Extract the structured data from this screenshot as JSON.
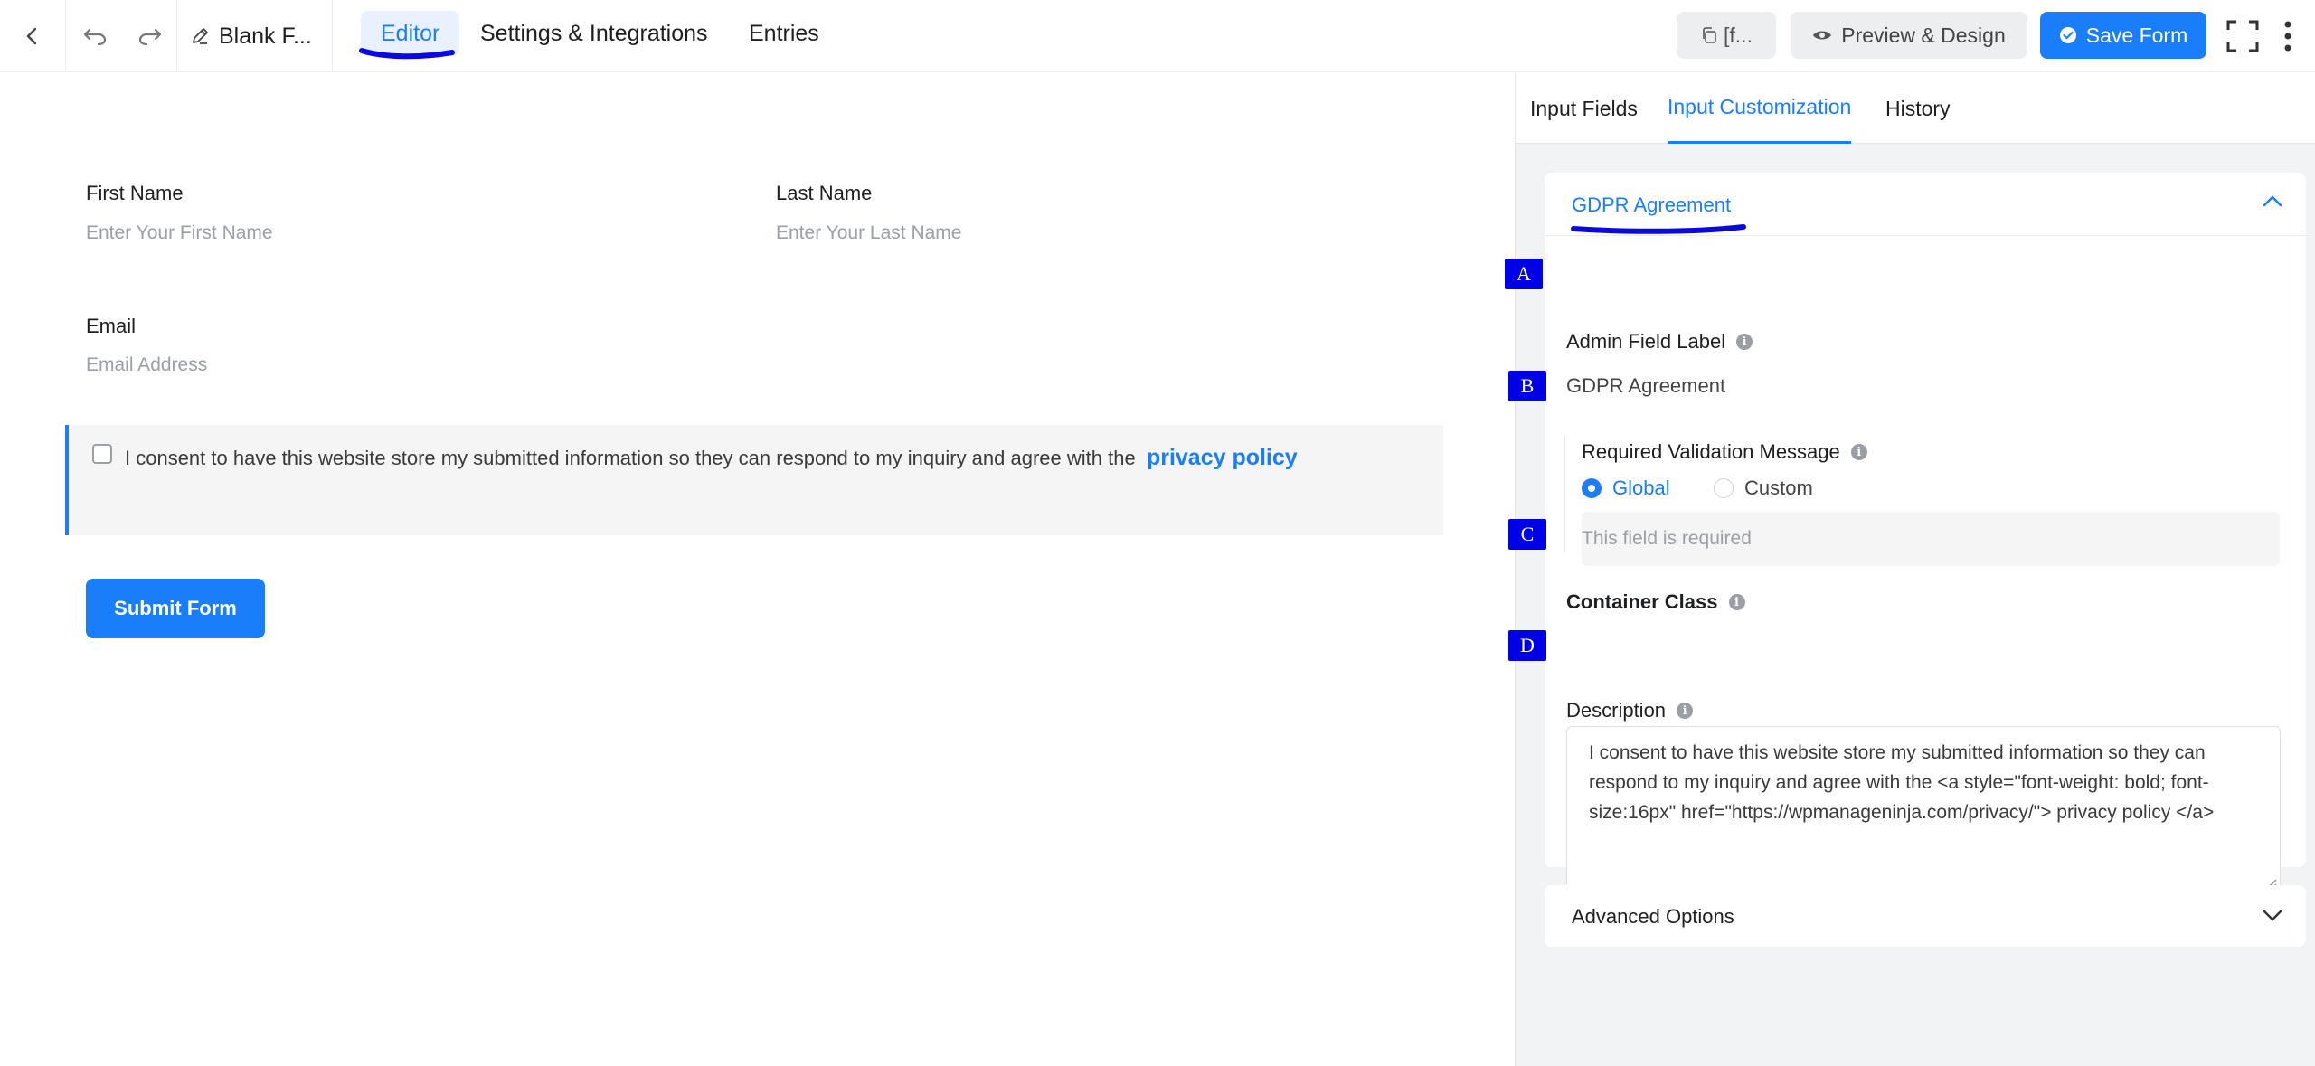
{
  "topbar": {
    "form_title": "Blank F...",
    "tabs": [
      {
        "label": "Editor",
        "active": true
      },
      {
        "label": "Settings & Integrations",
        "active": false
      },
      {
        "label": "Entries",
        "active": false
      }
    ],
    "shortcode_label": "[f...",
    "preview_label": "Preview & Design",
    "save_label": "Save Form"
  },
  "form": {
    "first_name": {
      "label": "First Name",
      "placeholder": "Enter Your First Name"
    },
    "last_name": {
      "label": "Last Name",
      "placeholder": "Enter Your Last Name"
    },
    "email": {
      "label": "Email",
      "placeholder": "Email Address"
    },
    "consent_text": "I consent to have this website store my submitted information so they can respond to my inquiry and agree with the",
    "consent_link": "privacy policy",
    "submit_label": "Submit Form"
  },
  "panel": {
    "tabs": [
      {
        "label": "Input Fields",
        "active": false
      },
      {
        "label": "Input Customization",
        "active": true
      },
      {
        "label": "History",
        "active": false
      }
    ],
    "section_title": "GDPR Agreement",
    "markers": [
      "A",
      "B",
      "C",
      "D"
    ],
    "admin_label": {
      "label": "Admin Field Label",
      "value": "GDPR Agreement"
    },
    "required_message": {
      "label": "Required Validation Message",
      "options": [
        "Global",
        "Custom"
      ],
      "selected": "Global",
      "placeholder": "This field is required"
    },
    "container_class": {
      "label": "Container Class"
    },
    "description": {
      "label": "Description",
      "value": "I consent to have this website store my submitted information so they can respond to my inquiry and agree with the <a style=\"font-weight: bold; font-size:16px\" href=\"https://wpmanageninja.com/privacy/\"> privacy policy </a>"
    },
    "advanced_title": "Advanced Options"
  },
  "colors": {
    "accent": "#1a7efb",
    "marker": "#0000e6",
    "annotation": "#0a0ae0"
  },
  "icons": [
    "back-arrow-icon",
    "undo-icon",
    "redo-icon",
    "pencil-icon",
    "copy-icon",
    "eye-icon",
    "check-circle-icon",
    "fullscreen-icon",
    "more-vertical-icon",
    "info-icon",
    "chevron-up-icon",
    "chevron-down-icon"
  ]
}
